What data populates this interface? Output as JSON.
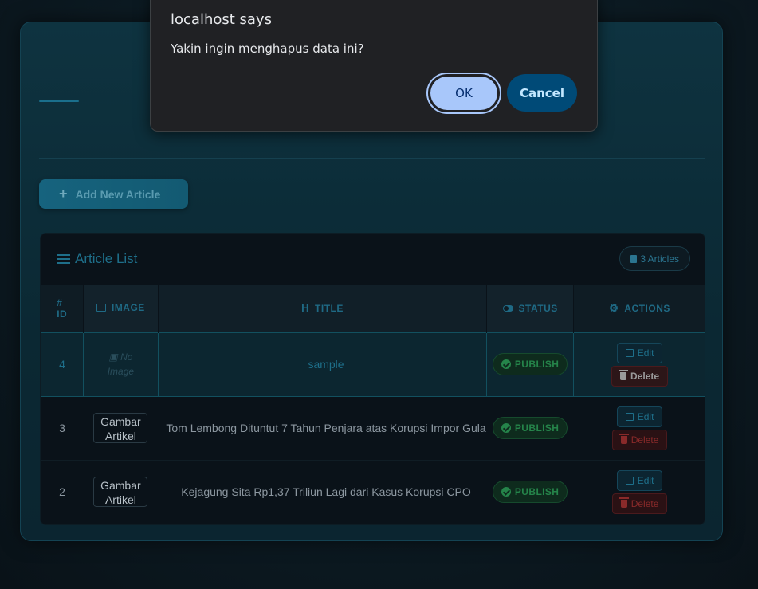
{
  "dialog": {
    "title": "localhost says",
    "message": "Yakin ingin menghapus data ini?",
    "ok_label": "OK",
    "cancel_label": "Cancel"
  },
  "toolbar": {
    "add_label": "Add New Article"
  },
  "article_list": {
    "title": "Article List",
    "count_label": "3 Articles",
    "columns": {
      "id_hash": "#",
      "id": "ID",
      "image": "IMAGE",
      "title": "TITLE",
      "status": "STATUS",
      "actions": "ACTIONS"
    },
    "rows": [
      {
        "id": "4",
        "image_text": [
          "No",
          "Image"
        ],
        "title": "sample",
        "status": "PUBLISH",
        "edit_label": "Edit",
        "delete_label": "Delete"
      },
      {
        "id": "3",
        "image_text": [
          "Gambar",
          "Artikel"
        ],
        "title": "Tom Lembong Dituntut 7 Tahun Penjara atas Korupsi Impor Gula",
        "status": "PUBLISH",
        "edit_label": "Edit",
        "delete_label": "Delete"
      },
      {
        "id": "2",
        "image_text": [
          "Gambar",
          "Artikel"
        ],
        "title": "Kejagung Sita Rp1,37 Triliun Lagi dari Kasus Korupsi CPO",
        "status": "PUBLISH",
        "edit_label": "Edit",
        "delete_label": "Delete"
      }
    ]
  },
  "colors": {
    "accent": "#1e6f8a",
    "publish": "#25844a",
    "danger": "#8a2a2a",
    "dialog_ok": "#a8c7fa",
    "dialog_cancel": "#004a77"
  }
}
